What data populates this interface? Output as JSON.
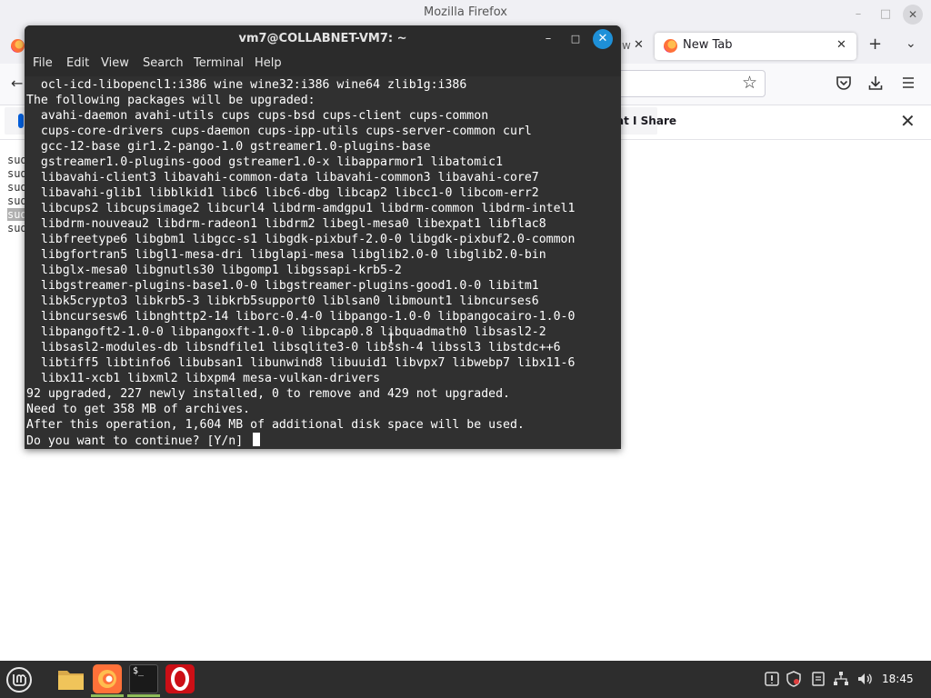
{
  "firefox": {
    "window_title": "Mozilla Firefox",
    "minimize": "–",
    "maximize": "□",
    "close": "✕",
    "tabs": [
      {
        "label": "New Tab",
        "close": "✕"
      }
    ],
    "prev_tab_fragment": "w",
    "prev_tab_close": "✕",
    "new_tab_button": "+",
    "tab_list_button": "⌄",
    "back_button": "←",
    "bookmark_star": "☆",
    "notification": {
      "text": "at I Share",
      "close": "✕"
    },
    "background_lines": [
      "sud",
      "sud",
      "sud",
      "sud",
      "sud",
      "sud"
    ]
  },
  "terminal": {
    "title": "vm7@COLLABNET-VM7: ~",
    "minimize": "–",
    "maximize": "□",
    "close": "✕",
    "menu": [
      "File",
      "Edit",
      "View",
      "Search",
      "Terminal",
      "Help"
    ],
    "lines": [
      "  ocl-icd-libopencl1:i386 wine wine32:i386 wine64 zlib1g:i386",
      "The following packages will be upgraded:",
      "  avahi-daemon avahi-utils cups cups-bsd cups-client cups-common",
      "  cups-core-drivers cups-daemon cups-ipp-utils cups-server-common curl",
      "  gcc-12-base gir1.2-pango-1.0 gstreamer1.0-plugins-base",
      "  gstreamer1.0-plugins-good gstreamer1.0-x libapparmor1 libatomic1",
      "  libavahi-client3 libavahi-common-data libavahi-common3 libavahi-core7",
      "  libavahi-glib1 libblkid1 libc6 libc6-dbg libcap2 libcc1-0 libcom-err2",
      "  libcups2 libcupsimage2 libcurl4 libdrm-amdgpu1 libdrm-common libdrm-intel1",
      "  libdrm-nouveau2 libdrm-radeon1 libdrm2 libegl-mesa0 libexpat1 libflac8",
      "  libfreetype6 libgbm1 libgcc-s1 libgdk-pixbuf-2.0-0 libgdk-pixbuf2.0-common",
      "  libgfortran5 libgl1-mesa-dri libglapi-mesa libglib2.0-0 libglib2.0-bin",
      "  libglx-mesa0 libgnutls30 libgomp1 libgssapi-krb5-2",
      "  libgstreamer-plugins-base1.0-0 libgstreamer-plugins-good1.0-0 libitm1",
      "  libk5crypto3 libkrb5-3 libkrb5support0 liblsan0 libmount1 libncurses6",
      "  libncursesw6 libnghttp2-14 liborc-0.4-0 libpango-1.0-0 libpangocairo-1.0-0",
      "  libpangoft2-1.0-0 libpangoxft-1.0-0 libpcap0.8 libquadmath0 libsasl2-2",
      "  libsasl2-modules-db libsndfile1 libsqlite3-0 libssh-4 libssl3 libstdc++6",
      "  libtiff5 libtinfo6 libubsan1 libunwind8 libuuid1 libvpx7 libwebp7 libx11-6",
      "  libx11-xcb1 libxml2 libxpm4 mesa-vulkan-drivers",
      "92 upgraded, 227 newly installed, 0 to remove and 429 not upgraded.",
      "Need to get 358 MB of archives.",
      "After this operation, 1,604 MB of additional disk space will be used."
    ],
    "prompt": "Do you want to continue? [Y/n] "
  },
  "taskbar": {
    "terminal_glyph": "$_",
    "clock": "18:45"
  },
  "colors": {
    "terminal_bg": "#303030",
    "terminal_close_blue": "#1e90d8",
    "taskbar_bg": "#2d2d2d",
    "mint_green": "#8fbc5a"
  },
  "icons": [
    "firefox-icon",
    "back-arrow-icon",
    "star-icon",
    "pocket-icon",
    "download-icon",
    "hamburger-menu-icon",
    "mint-menu-icon",
    "files-icon",
    "terminal-icon",
    "opera-icon",
    "update-icon",
    "shield-icon",
    "clipboard-icon",
    "network-icon",
    "volume-icon"
  ]
}
